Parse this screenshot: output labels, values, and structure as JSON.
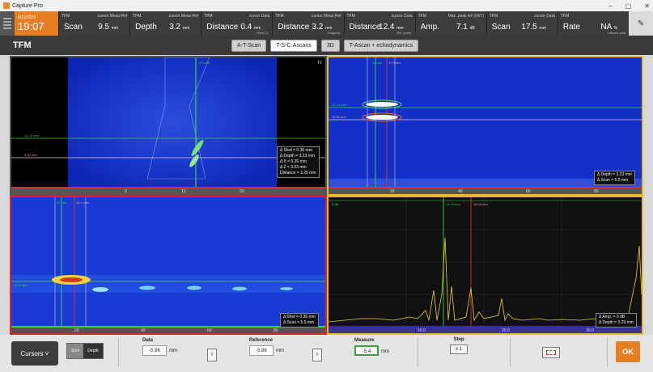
{
  "window": {
    "title": "Capture Pro",
    "controls": [
      "–",
      "▢",
      "✕"
    ]
  },
  "header": {
    "date": "6/11/2023",
    "time": "19:07",
    "readings": [
      {
        "tag": "TFM",
        "sub": "cursor Meas.Ref",
        "label": "Scan",
        "value": "9.5",
        "unit": "mm",
        "foot": ""
      },
      {
        "tag": "TFM",
        "sub": "cursor Meas.Ref",
        "label": "Depth",
        "value": "3.2",
        "unit": "mm",
        "foot": ""
      },
      {
        "tag": "TFM",
        "sub": "cursor Data",
        "label": "Distance",
        "value": "0.4",
        "unit": "mm",
        "foot": "Weld CL"
      },
      {
        "tag": "TFM",
        "sub": "cursor Meas.Ref",
        "label": "Distance",
        "value": "3.2",
        "unit": "mm",
        "foot": "Diagonal"
      },
      {
        "tag": "TFM",
        "sub": "cursor Data",
        "label": "Distance",
        "value": "12.4",
        "unit": "mm",
        "foot": "Ref. probe"
      },
      {
        "tag": "TFM",
        "sub": "Max. peak A# (cl67)",
        "label": "Amp.",
        "value": "7.1",
        "unit": "dB",
        "foot": ""
      },
      {
        "tag": "TFM",
        "sub": "cursor Data",
        "label": "Scan",
        "value": "17.5",
        "unit": "mm",
        "foot": ""
      },
      {
        "tag": "TFM",
        "sub": "",
        "label": "Rate",
        "value": "NA",
        "unit": "%",
        "foot": "Missed data"
      }
    ],
    "right_icon": "edit-icon"
  },
  "toolbar": {
    "mode": "TFM",
    "views": [
      "A-T-Scan",
      "T-S-C-Ascans",
      "3D",
      "T-Ascan + echodynamics"
    ],
    "active_view": "T-S-C-Ascans"
  },
  "panels": {
    "top_left": {
      "ruler_marks": [
        "0",
        "10",
        "20"
      ],
      "label_t": "T1",
      "labels": [
        "12.13 mm",
        "3.42 mm",
        "2.5 mm"
      ],
      "info": [
        "Δ Shot = 0.36 mm",
        "Δ Depth = 3.23 mm",
        "Δ X = 0.36 mm",
        "Δ Z = 3.03 mm",
        "Distance = 3.25 mm"
      ]
    },
    "top_right": {
      "ruler_marks": [
        "20",
        "40",
        "60",
        "80"
      ],
      "labels": [
        "12.13 mm",
        "15.41 mm",
        "12 mm",
        "17.5 mm"
      ],
      "info": [
        "Δ Depth = 3.23 mm",
        "Δ Scan = 5.5 mm"
      ]
    },
    "bottom_left": {
      "ruler_marks": [
        "20",
        "40",
        "60",
        "80"
      ],
      "labels": [
        "12 mm",
        "15.4 mm",
        "9.44 mm"
      ],
      "info": [
        "Δ Shot = 0.36 mm",
        "Δ Scan = 5.5 mm"
      ]
    },
    "bottom_right": {
      "ruler_marks": [
        "10.0",
        "20.0",
        "30.0"
      ],
      "labels": [
        "9 dB",
        "12.13 mm",
        "15.43 mm"
      ],
      "info": [
        "Δ Amp. = 0 dB",
        "Δ Depth = 3.29 mm"
      ]
    }
  },
  "bottom": {
    "cursors_label": "Cursors",
    "seg_options": [
      "Shot",
      "Depth"
    ],
    "seg_active": "Depth",
    "data": {
      "label": "Data",
      "value": "-5.96",
      "unit": "mm"
    },
    "reference": {
      "label": "Reference",
      "value": "-5.86",
      "unit": "mm"
    },
    "measure": {
      "label": "Measure",
      "value": "-5.4",
      "unit": "mm"
    },
    "step": {
      "label": "Step",
      "value": "x 1"
    },
    "ok_label": "OK"
  },
  "colors": {
    "accent": "#e67e22",
    "scan_bg": "#1230c8",
    "cursor_green": "#3ad23a",
    "cursor_red": "#e03030",
    "ascan": "#e6d23a"
  }
}
